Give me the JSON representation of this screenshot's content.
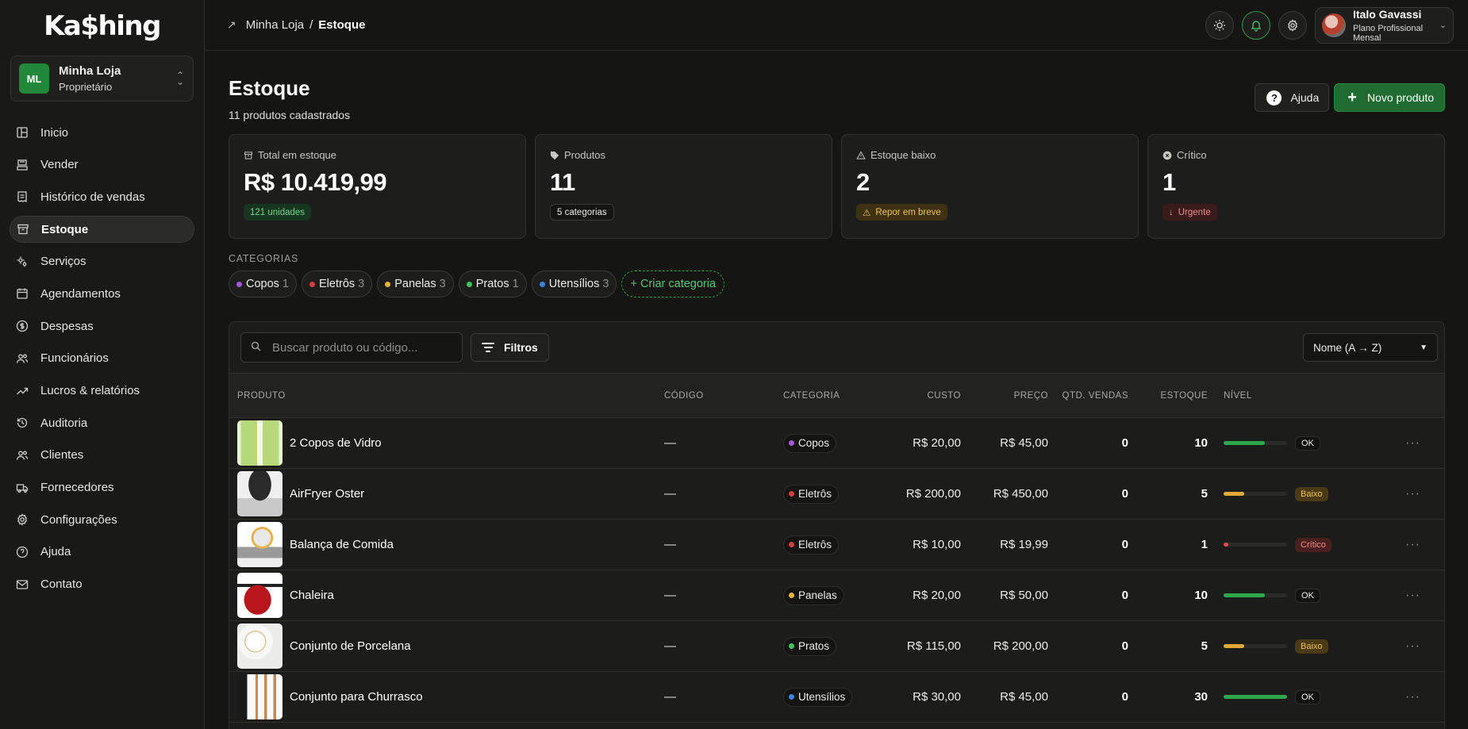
{
  "brand": {
    "logo": "Ka$hing"
  },
  "store": {
    "initials": "ML",
    "name": "Minha Loja",
    "role": "Proprietário"
  },
  "nav": [
    {
      "label": "Inicio",
      "icon": "layout-icon"
    },
    {
      "label": "Vender",
      "icon": "register-icon"
    },
    {
      "label": "Histórico de vendas",
      "icon": "receipt-icon"
    },
    {
      "label": "Estoque",
      "icon": "archive-icon",
      "active": true
    },
    {
      "label": "Serviços",
      "icon": "gears-icon"
    },
    {
      "label": "Agendamentos",
      "icon": "calendar-icon"
    },
    {
      "label": "Despesas",
      "icon": "dollar-circle-icon"
    },
    {
      "label": "Funcionários",
      "icon": "users-icon"
    },
    {
      "label": "Lucros & relatórios",
      "icon": "trend-icon"
    },
    {
      "label": "Auditoria",
      "icon": "history-icon"
    },
    {
      "label": "Clientes",
      "icon": "users-icon"
    },
    {
      "label": "Fornecedores",
      "icon": "truck-icon"
    },
    {
      "label": "Configurações",
      "icon": "gear-icon"
    },
    {
      "label": "Ajuda",
      "icon": "help-circle-icon"
    },
    {
      "label": "Contato",
      "icon": "mail-icon"
    }
  ],
  "breadcrumb": {
    "parent": "Minha Loja",
    "separator": "/",
    "current": "Estoque"
  },
  "user": {
    "name": "Italo Gavassi",
    "plan": "Plano Profissional Mensal"
  },
  "page": {
    "title": "Estoque",
    "subtitle": "11 produtos cadastrados",
    "help_label": "Ajuda",
    "new_label": "Novo produto"
  },
  "stats": [
    {
      "label": "Total em estoque",
      "value": "R$ 10.419,99",
      "badge": "121 unidades",
      "icon": "archive-icon",
      "tone": "green"
    },
    {
      "label": "Produtos",
      "value": "11",
      "badge": "5 categorias",
      "icon": "tag-icon",
      "tone": "neutral"
    },
    {
      "label": "Estoque baixo",
      "value": "2",
      "badge": "Repor em breve",
      "badge_icon": "⚠",
      "icon": "warning-icon",
      "tone": "amber"
    },
    {
      "label": "Crítico",
      "value": "1",
      "badge": "Urgente",
      "badge_icon": "↓",
      "icon": "x-circle-icon",
      "tone": "red"
    }
  ],
  "categories_title": "CATEGORIAS",
  "categories": [
    {
      "name": "Copos",
      "count": "1",
      "color": "#a35ad6"
    },
    {
      "name": "Eletrôs",
      "count": "3",
      "color": "#d93c3c"
    },
    {
      "name": "Panelas",
      "count": "3",
      "color": "#e6b43a"
    },
    {
      "name": "Pratos",
      "count": "1",
      "color": "#44c15a"
    },
    {
      "name": "Utensílios",
      "count": "3",
      "color": "#3b82e0"
    }
  ],
  "create_category_label": "+ Criar categoria",
  "search": {
    "placeholder": "Buscar produto ou código..."
  },
  "filter_label": "Filtros",
  "sort": {
    "value": "Nome (A → Z)"
  },
  "columns": [
    "PRODUTO",
    "CÓDIGO",
    "CATEGORIA",
    "CUSTO",
    "PREÇO",
    "QTD. VENDAS",
    "ESTOQUE",
    "NÍVEL"
  ],
  "products": [
    {
      "name": "2 Copos de Vidro",
      "code": "—",
      "category": "Copos",
      "cat_color": "#a35ad6",
      "cost": "R$ 20,00",
      "price": "R$ 45,00",
      "sales": "0",
      "stock": "10",
      "level": 0.65,
      "level_label": "OK",
      "level_tone": "ok",
      "thumb": "glasses"
    },
    {
      "name": "AirFryer Oster",
      "code": "—",
      "category": "Eletrôs",
      "cat_color": "#d93c3c",
      "cost": "R$ 200,00",
      "price": "R$ 450,00",
      "sales": "0",
      "stock": "5",
      "level": 0.32,
      "level_label": "Baixo",
      "level_tone": "low",
      "thumb": "airfryer"
    },
    {
      "name": "Balança de Comida",
      "code": "—",
      "category": "Eletrôs",
      "cat_color": "#d93c3c",
      "cost": "R$ 10,00",
      "price": "R$ 19,99",
      "sales": "0",
      "stock": "1",
      "level": 0.07,
      "level_label": "Crítico",
      "level_tone": "crit",
      "thumb": "scale"
    },
    {
      "name": "Chaleira",
      "code": "—",
      "category": "Panelas",
      "cat_color": "#e6b43a",
      "cost": "R$ 20,00",
      "price": "R$ 50,00",
      "sales": "0",
      "stock": "10",
      "level": 0.65,
      "level_label": "OK",
      "level_tone": "ok",
      "thumb": "kettle"
    },
    {
      "name": "Conjunto de Porcelana",
      "code": "—",
      "category": "Pratos",
      "cat_color": "#44c15a",
      "cost": "R$ 115,00",
      "price": "R$ 200,00",
      "sales": "0",
      "stock": "5",
      "level": 0.32,
      "level_label": "Baixo",
      "level_tone": "low",
      "thumb": "plates"
    },
    {
      "name": "Conjunto para Churrasco",
      "code": "—",
      "category": "Utensílios",
      "cat_color": "#3b82e0",
      "cost": "R$ 30,00",
      "price": "R$ 45,00",
      "sales": "0",
      "stock": "30",
      "level": 1.0,
      "level_label": "OK",
      "level_tone": "ok",
      "thumb": "knives"
    }
  ]
}
